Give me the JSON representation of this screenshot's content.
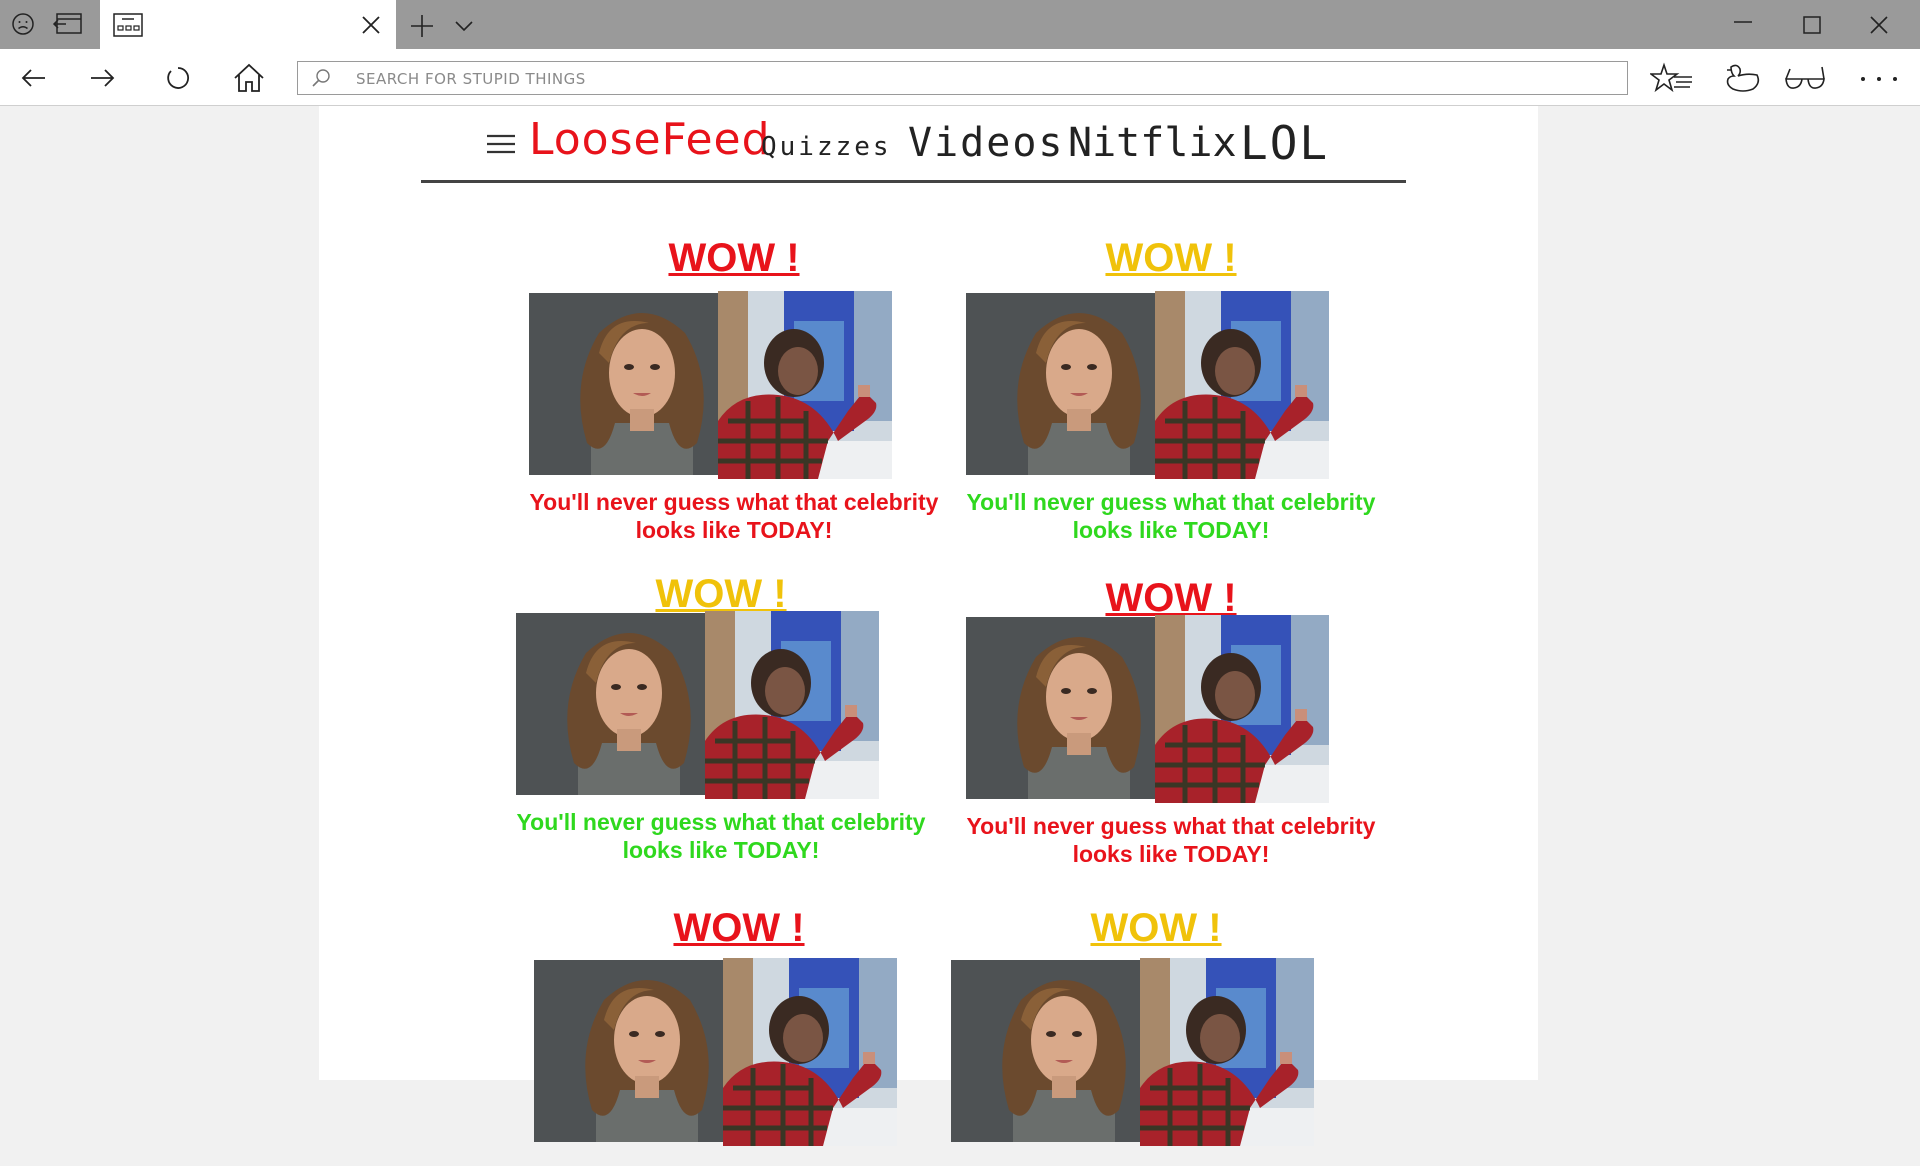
{
  "browser": {
    "address_placeholder": "SEARCH FOR STUPID THINGS"
  },
  "site": {
    "logo": "LooseFeed",
    "nav": [
      "Quizzes",
      "Videos",
      "Nitflix",
      "LOL"
    ]
  },
  "cards": [
    {
      "headline": "WOW !",
      "headline_color": "#e8131b",
      "caption": "You'll never guess what that celebrity looks like TODAY!",
      "caption_color": "#e8131b"
    },
    {
      "headline": "WOW !",
      "headline_color": "#f0c20a",
      "caption": "You'll never guess what that celebrity looks like TODAY!",
      "caption_color": "#2fd81e"
    },
    {
      "headline": "WOW !",
      "headline_color": "#f0c20a",
      "caption": "You'll never guess what that celebrity looks like TODAY!",
      "caption_color": "#2fd81e"
    },
    {
      "headline": "WOW !",
      "headline_color": "#e8131b",
      "caption": "You'll never guess what that celebrity looks like TODAY!",
      "caption_color": "#e8131b"
    },
    {
      "headline": "WOW !",
      "headline_color": "#e8131b",
      "caption": "",
      "caption_color": "#e8131b"
    },
    {
      "headline": "WOW !",
      "headline_color": "#f0c20a",
      "caption": "",
      "caption_color": "#2fd81e"
    }
  ],
  "colors": {
    "brand": "#e8131b",
    "titlebar": "#9a9a9a"
  }
}
